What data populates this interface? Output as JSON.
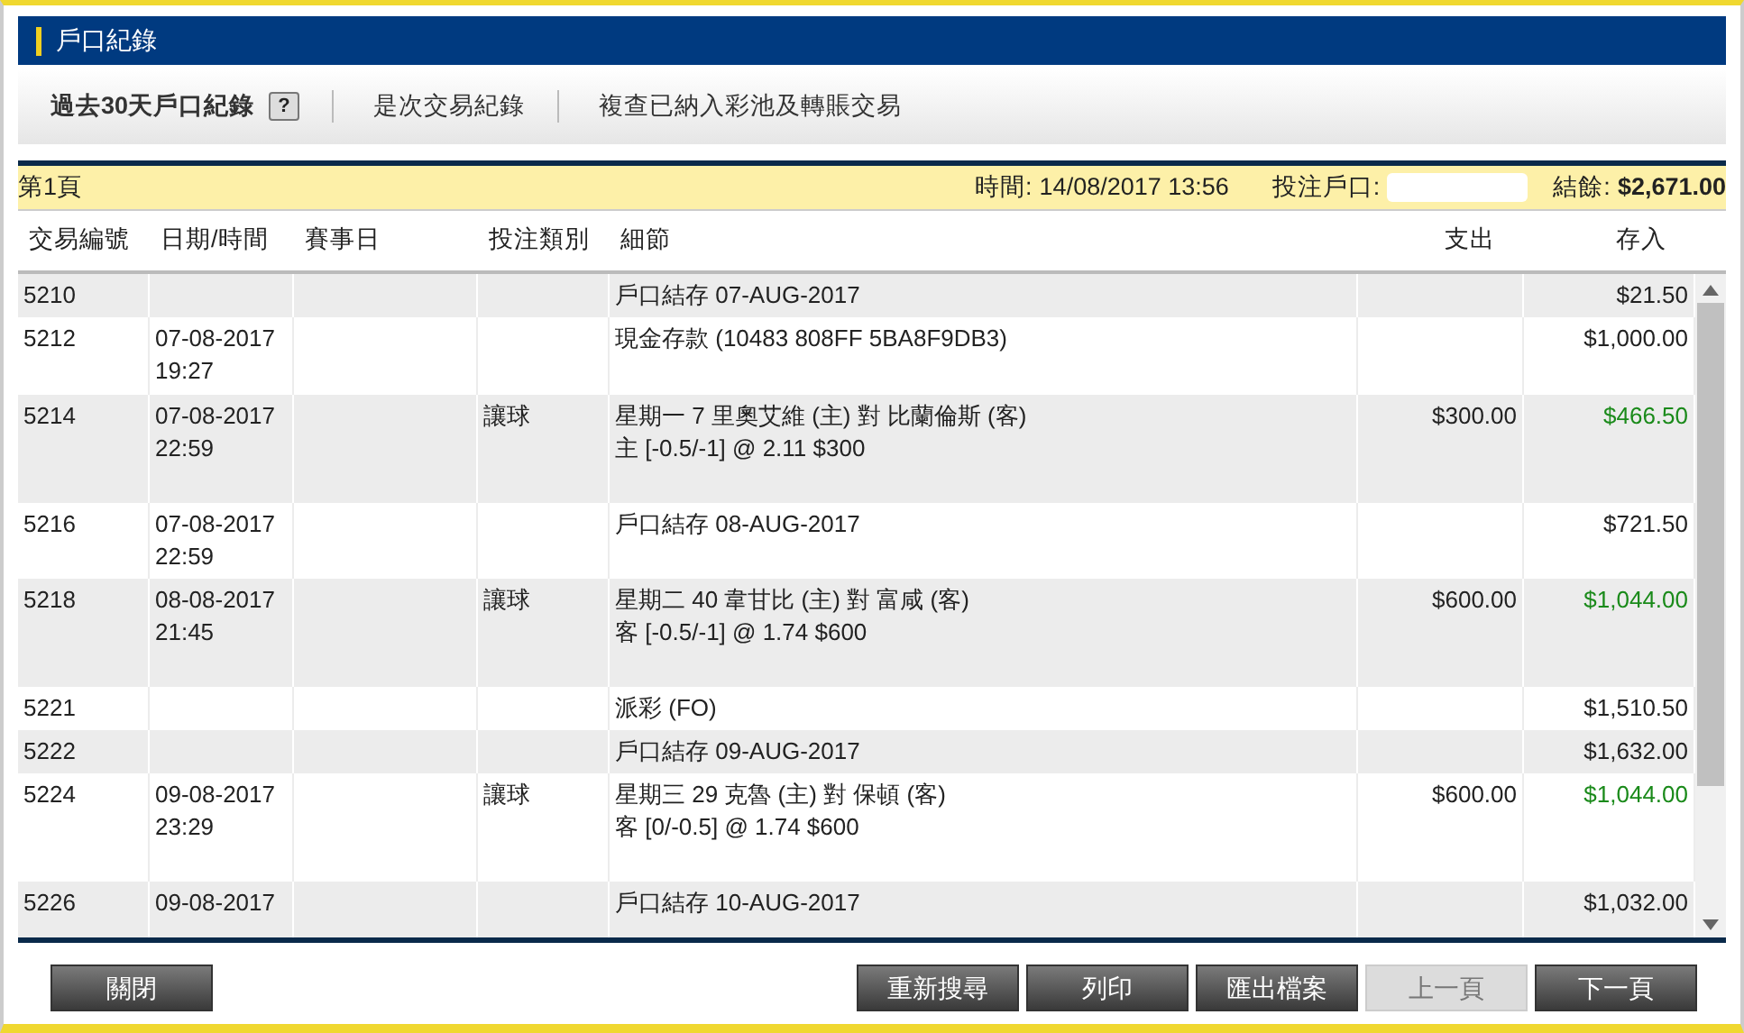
{
  "window": {
    "title": "戶口紀錄"
  },
  "tabs": [
    {
      "label": "過去30天戶口紀錄",
      "selected": true,
      "help": "?"
    },
    {
      "label": "是次交易紀錄",
      "selected": false
    },
    {
      "label": "複查已納入彩池及轉賬交易",
      "selected": false
    }
  ],
  "info_bar": {
    "page": "第1頁",
    "time_label": "時間:",
    "time": "14/08/2017 13:56",
    "account_label": "投注戶口:",
    "balance_label": "結餘:",
    "balance": "$2,671.00"
  },
  "table": {
    "columns": [
      "交易編號",
      "日期/時間",
      "賽事日",
      "投注類別",
      "細節",
      "支出",
      "存入"
    ],
    "rows": [
      {
        "id": "5210",
        "date": "",
        "time": "",
        "type": "",
        "details": [
          "戶口結存 07-AUG-2017"
        ],
        "out": "",
        "in": "$21.50",
        "highlight": false
      },
      {
        "id": "5212",
        "date": "07-08-2017",
        "time": "19:27",
        "type": "",
        "details": [
          "現金存款 (10483 808FF 5BA8F9DB3)"
        ],
        "out": "",
        "in": "$1,000.00",
        "highlight": false
      },
      {
        "id": "5214",
        "date": "07-08-2017",
        "time": "22:59",
        "type": "讓球",
        "details": [
          "星期一 7 里奧艾維 (主) 對 比蘭倫斯 (客)",
          "主 [-0.5/-1] @ 2.11 $300"
        ],
        "out": "$300.00",
        "in": "$466.50",
        "highlight": true
      },
      {
        "id": "5216",
        "date": "07-08-2017",
        "time": "22:59",
        "type": "",
        "details": [
          "戶口結存 08-AUG-2017"
        ],
        "out": "",
        "in": "$721.50",
        "highlight": false
      },
      {
        "id": "5218",
        "date": "08-08-2017",
        "time": "21:45",
        "type": "讓球",
        "details": [
          "星期二 40 韋甘比 (主) 對 富咸 (客)",
          "客 [-0.5/-1] @ 1.74 $600"
        ],
        "out": "$600.00",
        "in": "$1,044.00",
        "highlight": true
      },
      {
        "id": "5221",
        "date": "",
        "time": "",
        "type": "",
        "details": [
          "派彩 (FO)"
        ],
        "out": "",
        "in": "$1,510.50",
        "highlight": false
      },
      {
        "id": "5222",
        "date": "",
        "time": "",
        "type": "",
        "details": [
          "戶口結存 09-AUG-2017"
        ],
        "out": "",
        "in": "$1,632.00",
        "highlight": false
      },
      {
        "id": "5224",
        "date": "09-08-2017",
        "time": "23:29",
        "type": "讓球",
        "details": [
          "星期三 29 克魯 (主) 對 保頓 (客)",
          "客 [0/-0.5] @ 1.74 $600"
        ],
        "out": "$600.00",
        "in": "$1,044.00",
        "highlight": true
      },
      {
        "id": "5226",
        "date": "09-08-2017",
        "time": "",
        "type": "",
        "details": [
          "戶口結存 10-AUG-2017"
        ],
        "out": "",
        "in": "$1,032.00",
        "highlight": false
      }
    ]
  },
  "buttons_left": [
    {
      "label": "關閉",
      "disabled": false
    }
  ],
  "buttons_right": [
    {
      "label": "重新搜尋",
      "disabled": false
    },
    {
      "label": "列印",
      "disabled": false
    },
    {
      "label": "匯出檔案",
      "disabled": false
    },
    {
      "label": "上一頁",
      "disabled": true
    },
    {
      "label": "下一頁",
      "disabled": false
    }
  ]
}
